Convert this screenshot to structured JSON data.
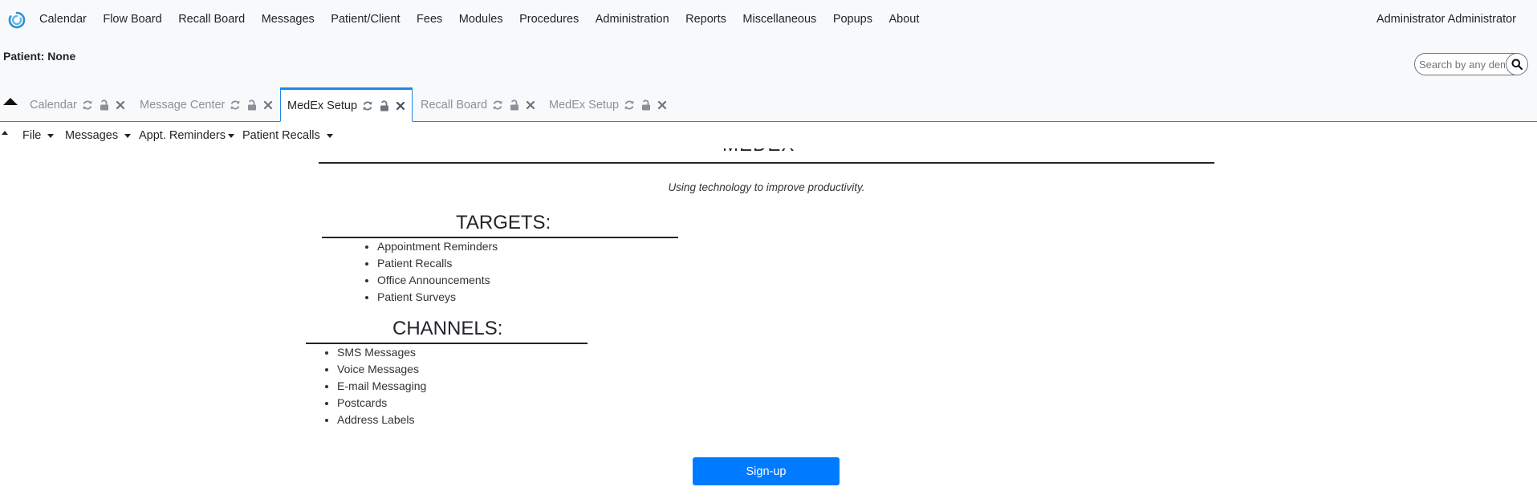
{
  "nav": {
    "items": [
      "Calendar",
      "Flow Board",
      "Recall Board",
      "Messages",
      "Patient/Client",
      "Fees",
      "Modules",
      "Procedures",
      "Administration",
      "Reports",
      "Miscellaneous",
      "Popups",
      "About"
    ],
    "user": "Administrator Administrator"
  },
  "patient": {
    "label": "Patient: None"
  },
  "search": {
    "placeholder": "Search by any demographics"
  },
  "tabs": [
    {
      "label": "Calendar",
      "active": false
    },
    {
      "label": "Message Center",
      "active": false
    },
    {
      "label": "MedEx Setup",
      "active": true
    },
    {
      "label": "Recall Board",
      "active": false
    },
    {
      "label": "MedEx Setup",
      "active": false
    }
  ],
  "submenu": [
    "File",
    "Messages",
    "Appt. Reminders",
    "Patient Recalls"
  ],
  "content": {
    "brand": "MEDEX",
    "tagline": "Using technology to improve productivity.",
    "targets_title": "TARGETS:",
    "targets": [
      "Appointment Reminders",
      "Patient Recalls",
      "Office Announcements",
      "Patient Surveys"
    ],
    "channels_title": "CHANNELS:",
    "channels": [
      "SMS Messages",
      "Voice Messages",
      "E-mail Messaging",
      "Postcards",
      "Address Labels"
    ],
    "signup_label": "Sign-up"
  },
  "colors": {
    "accent": "#1e88e5",
    "button": "#007bff",
    "navbg": "#f8f9fa"
  },
  "icons": {
    "logo": "openemr-logo-icon",
    "refresh": "refresh-icon",
    "lock": "unlock-icon",
    "close": "close-icon",
    "search": "search-icon"
  }
}
